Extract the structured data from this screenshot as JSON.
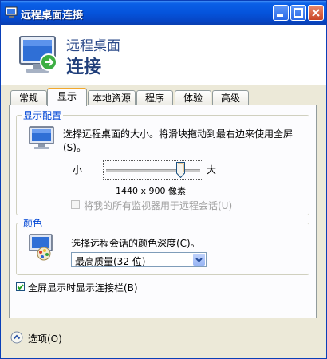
{
  "window": {
    "title": "远程桌面连接"
  },
  "header": {
    "line1": "远程桌面",
    "line2": "连接"
  },
  "tabs": [
    {
      "label": "常规"
    },
    {
      "label": "显示"
    },
    {
      "label": "本地资源"
    },
    {
      "label": "程序"
    },
    {
      "label": "体验"
    },
    {
      "label": "高级"
    }
  ],
  "active_tab": "显示",
  "display_config": {
    "title": "显示配置",
    "description": "选择远程桌面的大小。将滑块拖动到最右边来使用全屏(S)。",
    "small_label": "小",
    "large_label": "大",
    "slider_level_fraction": 0.8,
    "resolution": "1440 x 900 像素",
    "all_monitors_label": "将我的所有监视器用于远程会话(U)",
    "all_monitors_checked": false,
    "all_monitors_enabled": false
  },
  "colors_group": {
    "title": "颜色",
    "description": "选择远程会话的颜色深度(C)。",
    "selected_depth": "最高质量(32 位)"
  },
  "connection_bar": {
    "label": "全屏显示时显示连接栏(B)",
    "checked": true
  },
  "options_toggle": {
    "label": "选项(O)"
  },
  "colors": {
    "titlebar": "#0554dc",
    "accent": "#0046d5",
    "tab_highlight": "#f2a72c"
  },
  "icons": {
    "title": "remote-desktop-icon",
    "header": "monitor-connection-icon",
    "display": "display-monitor-icon",
    "color": "color-palette-icon",
    "options": "chevron-up-circle-icon"
  }
}
